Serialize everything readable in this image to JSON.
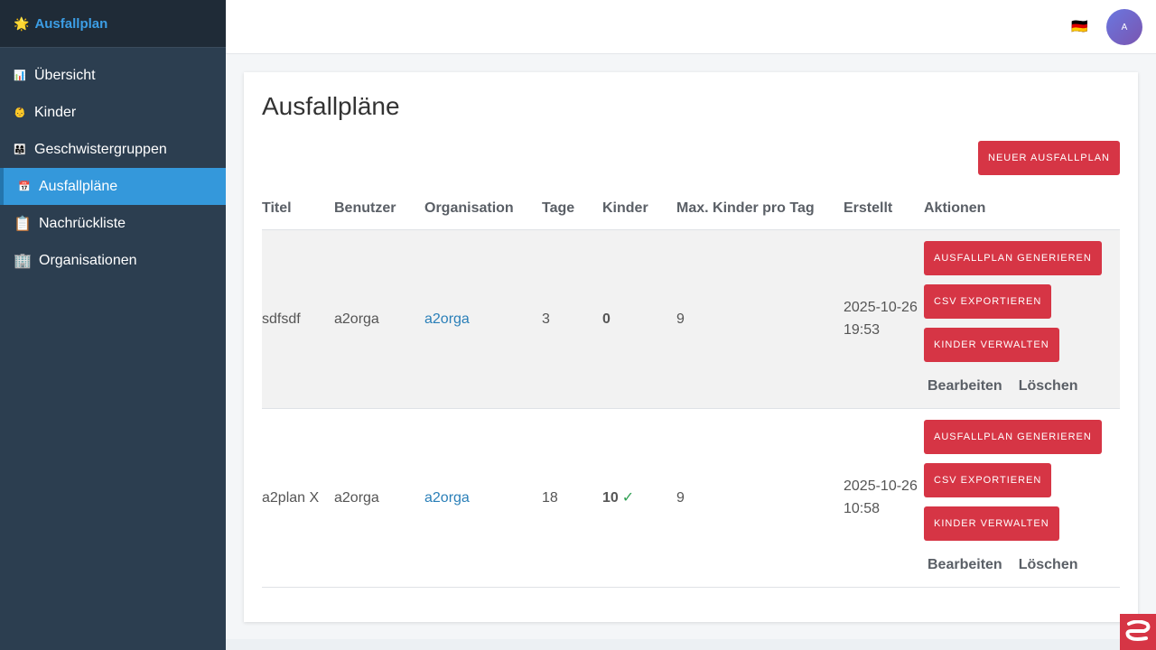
{
  "app": {
    "brand_icon": "🌟",
    "title": "Ausfallplan"
  },
  "sidebar": {
    "items": [
      {
        "icon": "📊",
        "label": "Übersicht"
      },
      {
        "icon": "👶",
        "label": "Kinder"
      },
      {
        "icon": "👨‍👩‍👧",
        "label": "Geschwistergruppen"
      },
      {
        "icon": "📅",
        "label": "Ausfallpläne"
      },
      {
        "icon": "📋",
        "label": "Nachrückliste"
      },
      {
        "icon": "🏢",
        "label": "Organisationen"
      }
    ],
    "active_index": 3
  },
  "topbar": {
    "language_flag": "🇩🇪",
    "avatar_initial": "A"
  },
  "page": {
    "title": "Ausfallpläne",
    "new_button_label": "Neuer Ausfallplan"
  },
  "table": {
    "headers": [
      "Titel",
      "Benutzer",
      "Organisation",
      "Tage",
      "Kinder",
      "Max. Kinder pro Tag",
      "Erstellt",
      "Aktionen"
    ],
    "rows": [
      {
        "title": "sdfsdf",
        "user": "a2orga",
        "organization": "a2orga",
        "days": "3",
        "children": "0",
        "children_check": "",
        "max_children": "9",
        "created": "2025-10-26 19:53"
      },
      {
        "title": "a2plan X",
        "user": "a2orga",
        "organization": "a2orga",
        "days": "18",
        "children": "10",
        "children_check": "✓",
        "max_children": "9",
        "created": "2025-10-26 10:58"
      }
    ],
    "actions": {
      "generate": "Ausfallplan generieren",
      "export_csv": "CSV exportieren",
      "manage_children": "Kinder verwalten",
      "edit": "Bearbeiten",
      "delete": "Löschen"
    }
  },
  "colors": {
    "sidebar": "#2c3e50",
    "active": "#3498db",
    "brand": "#3c9ee5",
    "danger": "#d63545",
    "link": "#2a7fb8"
  }
}
